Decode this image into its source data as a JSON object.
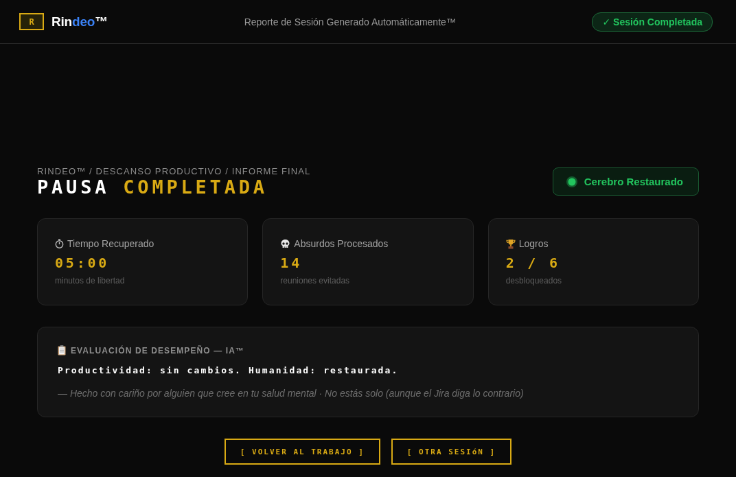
{
  "header": {
    "logo": {
      "letter": "R",
      "wordmark": [
        {
          "text": "Rin",
          "accent": false
        },
        {
          "text": "deo",
          "accent": true
        },
        {
          "text": "™",
          "accent": false
        }
      ]
    },
    "subtitle": "Reporte de Sesión Generado Automáticamente™",
    "status_badge": "✓ Sesión Completada"
  },
  "report": {
    "breadcrumb": "RINDEO™ / DESCANSO PRODUCTIVO / INFORME FINAL",
    "title": [
      {
        "text": "PAUSA",
        "accent": false
      },
      {
        "text": "COMPLETADA",
        "accent": true
      }
    ],
    "status": "Cerebro Restaurado"
  },
  "stats": [
    {
      "label": "Tiempo Recuperado",
      "value": "05:00",
      "caption": "minutos de libertad"
    },
    {
      "label": "Absurdos Procesados",
      "value": "14",
      "caption": "reuniones evitadas"
    },
    {
      "label": "Logros",
      "value": "2 / 6",
      "caption": "desbloqueados"
    }
  ],
  "evaluation": {
    "heading": "EVALUACIÓN DE DESEMPEÑO — IA™",
    "verdict": "Productividad: sin cambios. Humanidad: restaurada.",
    "note": "— Hecho con cariño por alguien que cree en tu salud mental · No estás solo (aunque el Jira diga lo contrario)"
  },
  "buttons": [
    "[ VOLVER AL TRABAJO ]",
    "[ OTRA SESIóN ]"
  ]
}
